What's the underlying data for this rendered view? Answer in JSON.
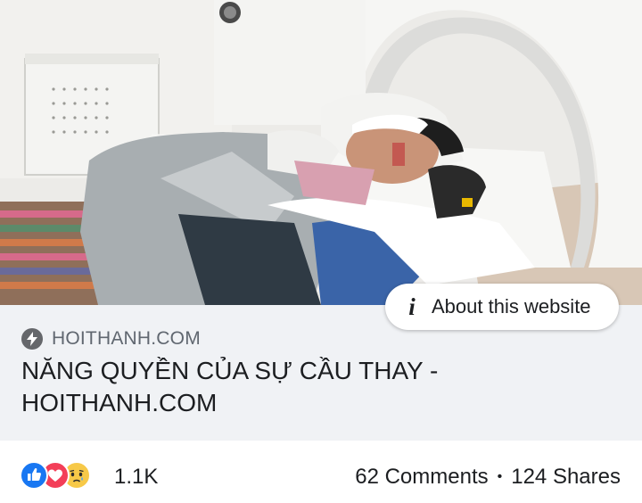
{
  "post": {
    "image": {
      "description_icon": "photo"
    },
    "about_button": {
      "icon": "info-icon",
      "label": "About this website"
    },
    "link_preview": {
      "domain_icon": "bolt-icon",
      "domain": "HOITHANH.COM",
      "title": "NĂNG QUYỀN CỦA SỰ CẦU THAY - HOITHANH.COM"
    },
    "reactions": {
      "icons": [
        "like-icon",
        "love-icon",
        "sad-icon"
      ],
      "count": "1.1K",
      "comments": "62 Comments",
      "separator": "•",
      "shares": "124 Shares"
    }
  },
  "colors": {
    "link_box_bg": "#f0f2f5",
    "like": "#1877f2",
    "love": "#f33e58",
    "sad": "#f7c948",
    "domain_text": "#606770"
  }
}
